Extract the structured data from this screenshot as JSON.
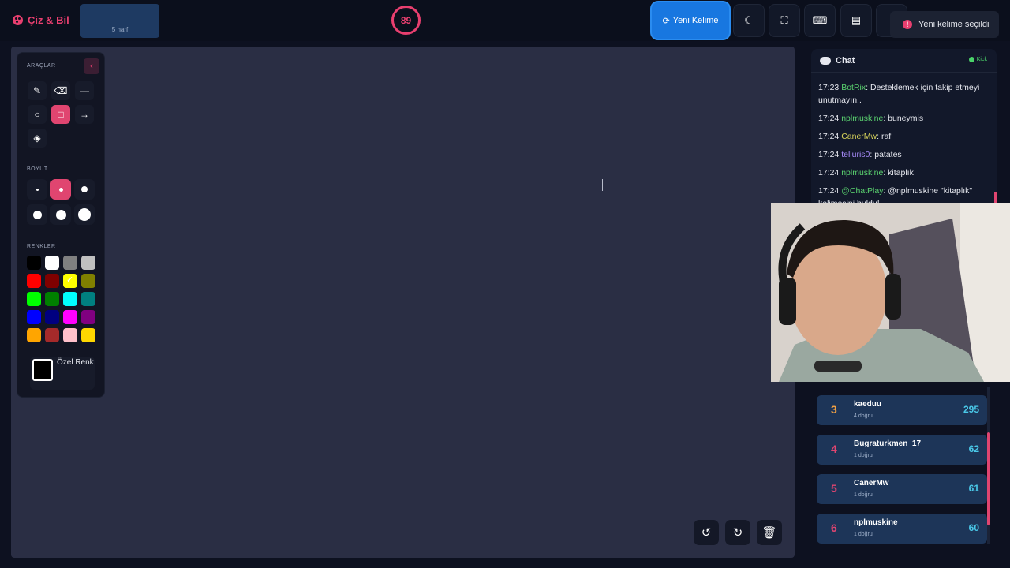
{
  "app": {
    "title": "Çiz & Bil"
  },
  "word": {
    "mask": "_ _ _ _ _",
    "hint": "5 harf"
  },
  "timer": {
    "value": "89"
  },
  "toolbar": {
    "new_word": "Yeni Kelime",
    "icons": [
      "moon-icon",
      "fullscreen-icon",
      "keyboard-icon",
      "archive-icon",
      "info-icon"
    ]
  },
  "toast": {
    "text": "Yeni kelime seçildi"
  },
  "tools": {
    "title": "ARAÇLAR",
    "size_title": "BOYUT",
    "color_title": "RENKLER",
    "custom_color": "Özel Renk",
    "colors": [
      "#000000",
      "#ffffff",
      "#808080",
      "#c0c0c0",
      "#ff0000",
      "#800000",
      "#ffff00",
      "#808000",
      "#00ff00",
      "#008000",
      "#00ffff",
      "#008080",
      "#0000ff",
      "#000080",
      "#ff00ff",
      "#800080",
      "#ffa500",
      "#a52a2a",
      "#ffc0cb",
      "#ffd700"
    ],
    "selected_color": "#ffff00",
    "active_tool": "rectangle",
    "active_size": 2
  },
  "chat": {
    "title": "Chat",
    "platform": "Kick",
    "messages": [
      {
        "time": "17:23",
        "user": "BotRix",
        "color": "#5ad26f",
        "text": ": Desteklemek için takip etmeyi unutmayın.."
      },
      {
        "time": "17:24",
        "user": "nplmuskine",
        "color": "#5ad26f",
        "text": ": buneymis"
      },
      {
        "time": "17:24",
        "user": "CanerMw",
        "color": "#d7d35a",
        "text": ": raf"
      },
      {
        "time": "17:24",
        "user": "telluris0",
        "color": "#a78bfa",
        "text": ": patates"
      },
      {
        "time": "17:24",
        "user": "nplmuskine",
        "color": "#5ad26f",
        "text": ": kitaplık"
      },
      {
        "time": "17:24",
        "user": "@ChatPlay",
        "color": "#5ad26f",
        "text": ": @nplmuskine \"kitaplık\" kelimesini buldu!"
      }
    ]
  },
  "leaderboard": [
    {
      "rank": "3",
      "name": "kaeduu",
      "sub": "4 doğru",
      "points": "295",
      "color": "#f0a044"
    },
    {
      "rank": "4",
      "name": "Bugraturkmen_17",
      "sub": "1 doğru",
      "points": "62",
      "color": "#e04570"
    },
    {
      "rank": "5",
      "name": "CanerMw",
      "sub": "1 doğru",
      "points": "61",
      "color": "#e04570"
    },
    {
      "rank": "6",
      "name": "nplmuskine",
      "sub": "1 doğru",
      "points": "60",
      "color": "#e04570"
    }
  ]
}
